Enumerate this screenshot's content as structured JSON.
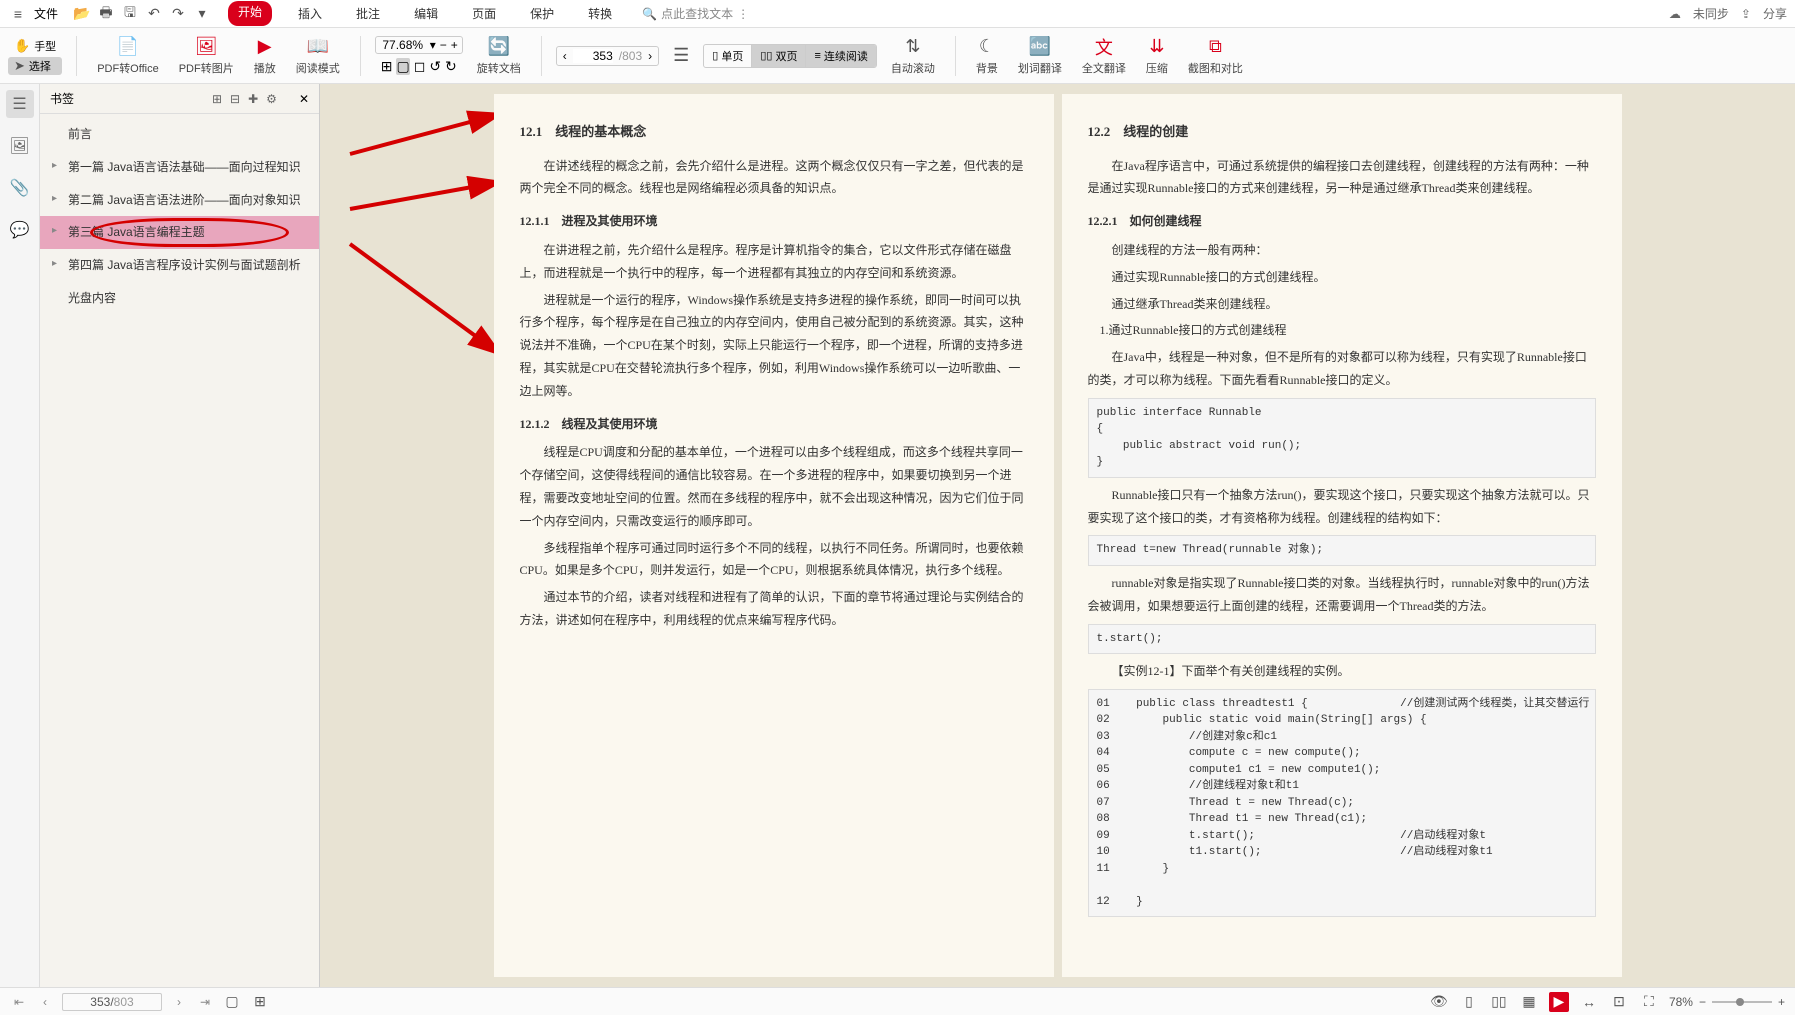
{
  "menu": {
    "file_label": "文件",
    "tabs": [
      "开始",
      "插入",
      "批注",
      "编辑",
      "页面",
      "保护",
      "转换"
    ],
    "active_tab_index": 0,
    "search_placeholder": "点此查找文本",
    "sync_status": "未同步",
    "share_label": "分享"
  },
  "toolbar": {
    "hand_label": "手型",
    "select_label": "选择",
    "pdf_to_office": "PDF转Office",
    "pdf_to_image": "PDF转图片",
    "play": "播放",
    "read_mode": "阅读模式",
    "zoom_pct": "77.68%",
    "rotate": "旋转文档",
    "page_current": "353",
    "page_total": "803",
    "single_page": "单页",
    "double_page": "双页",
    "continuous": "连续阅读",
    "auto_scroll": "自动滚动",
    "background": "背景",
    "word_translate": "划词翻译",
    "full_translate": "全文翻译",
    "compress": "压缩",
    "screenshot_compare": "截图和对比"
  },
  "sidebar": {
    "title": "书签",
    "items": [
      {
        "label": "前言",
        "children": false
      },
      {
        "label": "第一篇 Java语言语法基础——面向过程知识",
        "children": true
      },
      {
        "label": "第二篇 Java语言语法进阶——面向对象知识",
        "children": true
      },
      {
        "label": "第三篇 Java语言编程主题",
        "children": true,
        "selected": true,
        "circled": true
      },
      {
        "label": "第四篇 Java语言程序设计实例与面试题剖析",
        "children": true
      },
      {
        "label": "光盘内容",
        "children": false
      }
    ]
  },
  "page_left": {
    "h1": "12.1　线程的基本概念",
    "p1": "在讲述线程的概念之前，会先介绍什么是进程。这两个概念仅仅只有一字之差，但代表的是两个完全不同的概念。线程也是网络编程必须具备的知识点。",
    "h2": "12.1.1　进程及其使用环境",
    "p2": "在讲进程之前，先介绍什么是程序。程序是计算机指令的集合，它以文件形式存储在磁盘上，而进程就是一个执行中的程序，每一个进程都有其独立的内存空间和系统资源。",
    "p3": "进程就是一个运行的程序，Windows操作系统是支持多进程的操作系统，即同一时间可以执行多个程序，每个程序是在自己独立的内存空间内，使用自己被分配到的系统资源。其实，这种说法并不准确，一个CPU在某个时刻，实际上只能运行一个程序，即一个进程，所谓的支持多进程，其实就是CPU在交替轮流执行多个程序，例如，利用Windows操作系统可以一边听歌曲、一边上网等。",
    "h3": "12.1.2　线程及其使用环境",
    "p4": "线程是CPU调度和分配的基本单位，一个进程可以由多个线程组成，而这多个线程共享同一个存储空间，这使得线程间的通信比较容易。在一个多进程的程序中，如果要切换到另一个进程，需要改变地址空间的位置。然而在多线程的程序中，就不会出现这种情况，因为它们位于同一个内存空间内，只需改变运行的顺序即可。",
    "p5": "多线程指单个程序可通过同时运行多个不同的线程，以执行不同任务。所谓同时，也要依赖CPU。如果是多个CPU，则并发运行，如是一个CPU，则根据系统具体情况，执行多个线程。",
    "p6": "通过本节的介绍，读者对线程和进程有了简单的认识，下面的章节将通过理论与实例结合的方法，讲述如何在程序中，利用线程的优点来编写程序代码。"
  },
  "page_right": {
    "h1": "12.2　线程的创建",
    "p1": "在Java程序语言中，可通过系统提供的编程接口去创建线程，创建线程的方法有两种：一种是通过实现Runnable接口的方式来创建线程，另一种是通过继承Thread类来创建线程。",
    "h2": "12.2.1　如何创建线程",
    "p2": "创建线程的方法一般有两种：",
    "li1": "通过实现Runnable接口的方式创建线程。",
    "li2": "通过继承Thread类来创建线程。",
    "li3": "1.通过Runnable接口的方式创建线程",
    "p3": "在Java中，线程是一种对象，但不是所有的对象都可以称为线程，只有实现了Runnable接口的类，才可以称为线程。下面先看看Runnable接口的定义。",
    "code1": "public interface Runnable\n{\n    public abstract void run();\n}",
    "p4": "Runnable接口只有一个抽象方法run()，要实现这个接口，只要实现这个抽象方法就可以。只要实现了这个接口的类，才有资格称为线程。创建线程的结构如下：",
    "code2": "Thread t=new Thread(runnable 对象);",
    "p5": "runnable对象是指实现了Runnable接口类的对象。当线程执行时，runnable对象中的run()方法会被调用，如果想要运行上面创建的线程，还需要调用一个Thread类的方法。",
    "code3": "t.start();",
    "p6": "【实例12-1】下面举个有关创建线程的实例。",
    "code4": "01    public class threadtest1 {              //创建测试两个线程类，让其交替运行\n02        public static void main(String[] args) {\n03            //创建对象c和c1\n04            compute c = new compute();\n05            compute1 c1 = new compute1();\n06            //创建线程对象t和t1\n07            Thread t = new Thread(c);\n08            Thread t1 = new Thread(c1);\n09            t.start();                      //启动线程对象t\n10            t1.start();                     //启动线程对象t1\n11        }\n\n12    }"
  },
  "statusbar": {
    "page_current": "353",
    "page_total": "803",
    "zoom_pct": "78%"
  }
}
